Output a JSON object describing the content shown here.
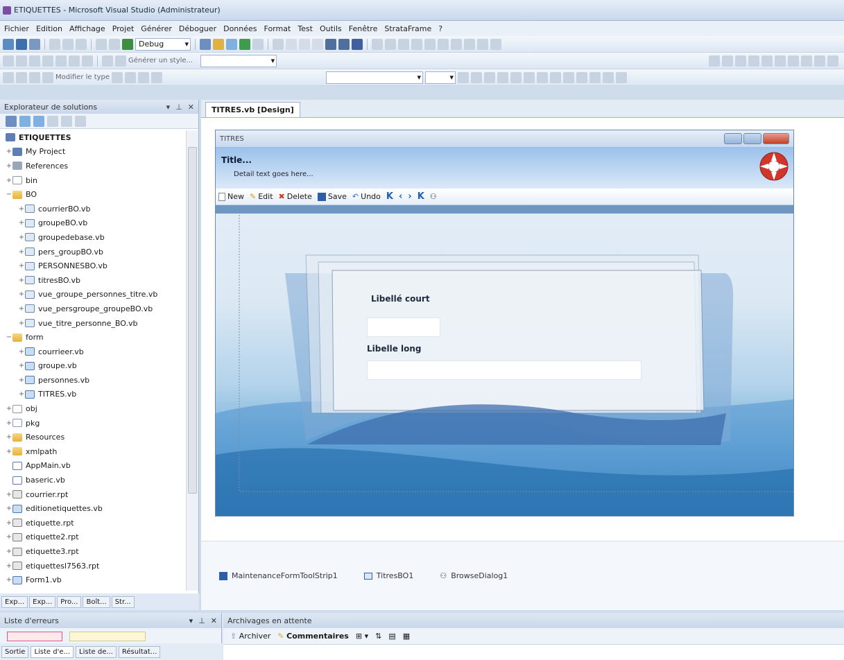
{
  "window": {
    "title": "ETIQUETTES - Microsoft Visual Studio (Administrateur)"
  },
  "menu": [
    "Fichier",
    "Edition",
    "Affichage",
    "Projet",
    "Générer",
    "Déboguer",
    "Données",
    "Format",
    "Test",
    "Outils",
    "Fenêtre",
    "StrataFrame",
    "?"
  ],
  "toolbar": {
    "config_combo": "Debug",
    "style_button": "Générer un style...",
    "modify_type_button": "Modifier le type"
  },
  "solution_explorer": {
    "title": "Explorateur de solutions",
    "project": "ETIQUETTES",
    "items": [
      {
        "label": "My Project",
        "icon": "proj",
        "indent": 1,
        "exp": "+"
      },
      {
        "label": "References",
        "icon": "refs",
        "indent": 1,
        "exp": "+"
      },
      {
        "label": "bin",
        "icon": "folder-empty",
        "indent": 1,
        "exp": "+"
      },
      {
        "label": "BO",
        "icon": "folder",
        "indent": 1,
        "exp": "−"
      },
      {
        "label": "courrierBO.vb",
        "icon": "vb",
        "indent": 2,
        "exp": "+"
      },
      {
        "label": "groupeBO.vb",
        "icon": "vb",
        "indent": 2,
        "exp": "+"
      },
      {
        "label": "groupedebase.vb",
        "icon": "vb",
        "indent": 2,
        "exp": "+"
      },
      {
        "label": "pers_groupBO.vb",
        "icon": "vb",
        "indent": 2,
        "exp": "+"
      },
      {
        "label": "PERSONNESBO.vb",
        "icon": "vb",
        "indent": 2,
        "exp": "+"
      },
      {
        "label": "titresBO.vb",
        "icon": "vb",
        "indent": 2,
        "exp": "+"
      },
      {
        "label": "vue_groupe_personnes_titre.vb",
        "icon": "vb",
        "indent": 2,
        "exp": "+"
      },
      {
        "label": "vue_persgroupe_groupeBO.vb",
        "icon": "vb",
        "indent": 2,
        "exp": "+"
      },
      {
        "label": "vue_titre_personne_BO.vb",
        "icon": "vb",
        "indent": 2,
        "exp": "+"
      },
      {
        "label": "form",
        "icon": "folder",
        "indent": 1,
        "exp": "−"
      },
      {
        "label": "courrieer.vb",
        "icon": "form",
        "indent": 2,
        "exp": "+"
      },
      {
        "label": "groupe.vb",
        "icon": "form",
        "indent": 2,
        "exp": "+"
      },
      {
        "label": "personnes.vb",
        "icon": "form",
        "indent": 2,
        "exp": "+"
      },
      {
        "label": "TITRES.vb",
        "icon": "form",
        "indent": 2,
        "exp": "+"
      },
      {
        "label": "obj",
        "icon": "folder-empty",
        "indent": 1,
        "exp": "+"
      },
      {
        "label": "pkg",
        "icon": "folder-empty",
        "indent": 1,
        "exp": "+"
      },
      {
        "label": "Resources",
        "icon": "folder",
        "indent": 1,
        "exp": "+"
      },
      {
        "label": "xmlpath",
        "icon": "folder",
        "indent": 1,
        "exp": "+"
      },
      {
        "label": "AppMain.vb",
        "icon": "app",
        "indent": 1,
        "exp": ""
      },
      {
        "label": "baseric.vb",
        "icon": "app",
        "indent": 1,
        "exp": ""
      },
      {
        "label": "courrier.rpt",
        "icon": "rpt",
        "indent": 1,
        "exp": "+"
      },
      {
        "label": "editionetiquettes.vb",
        "icon": "form",
        "indent": 1,
        "exp": "+"
      },
      {
        "label": "etiquette.rpt",
        "icon": "rpt",
        "indent": 1,
        "exp": "+"
      },
      {
        "label": "etiquette2.rpt",
        "icon": "rpt",
        "indent": 1,
        "exp": "+"
      },
      {
        "label": "etiquette3.rpt",
        "icon": "rpt",
        "indent": 1,
        "exp": "+"
      },
      {
        "label": "etiquettesl7563.rpt",
        "icon": "rpt",
        "indent": 1,
        "exp": "+"
      },
      {
        "label": "Form1.vb",
        "icon": "form",
        "indent": 1,
        "exp": "+"
      }
    ],
    "bottom_tabs": [
      "Exp...",
      "Exp...",
      "Pro...",
      "Boît...",
      "Str..."
    ]
  },
  "document": {
    "tab": "TITRES.vb [Design]",
    "form_title": "TITRES",
    "header_title": "Title...",
    "header_detail": "Detail text goes here...",
    "toolstrip": {
      "new": "New",
      "edit": "Edit",
      "delete": "Delete",
      "save": "Save",
      "undo": "Undo"
    },
    "label_short": "Libellé court",
    "label_long": "Libelle long",
    "components": [
      "MaintenanceFormToolStrip1",
      "TitresBO1",
      "BrowseDialog1"
    ]
  },
  "bottom": {
    "error_list_title": "Liste d'erreurs",
    "pending_title": "Archivages en attente",
    "archive_button": "Archiver",
    "comments_button": "Commentaires",
    "tabs": [
      "Sortie",
      "Liste d'e...",
      "Liste de...",
      "Résultat..."
    ]
  },
  "colors": {
    "accent": "#4f79ad",
    "delete_red": "#d13a1e"
  }
}
